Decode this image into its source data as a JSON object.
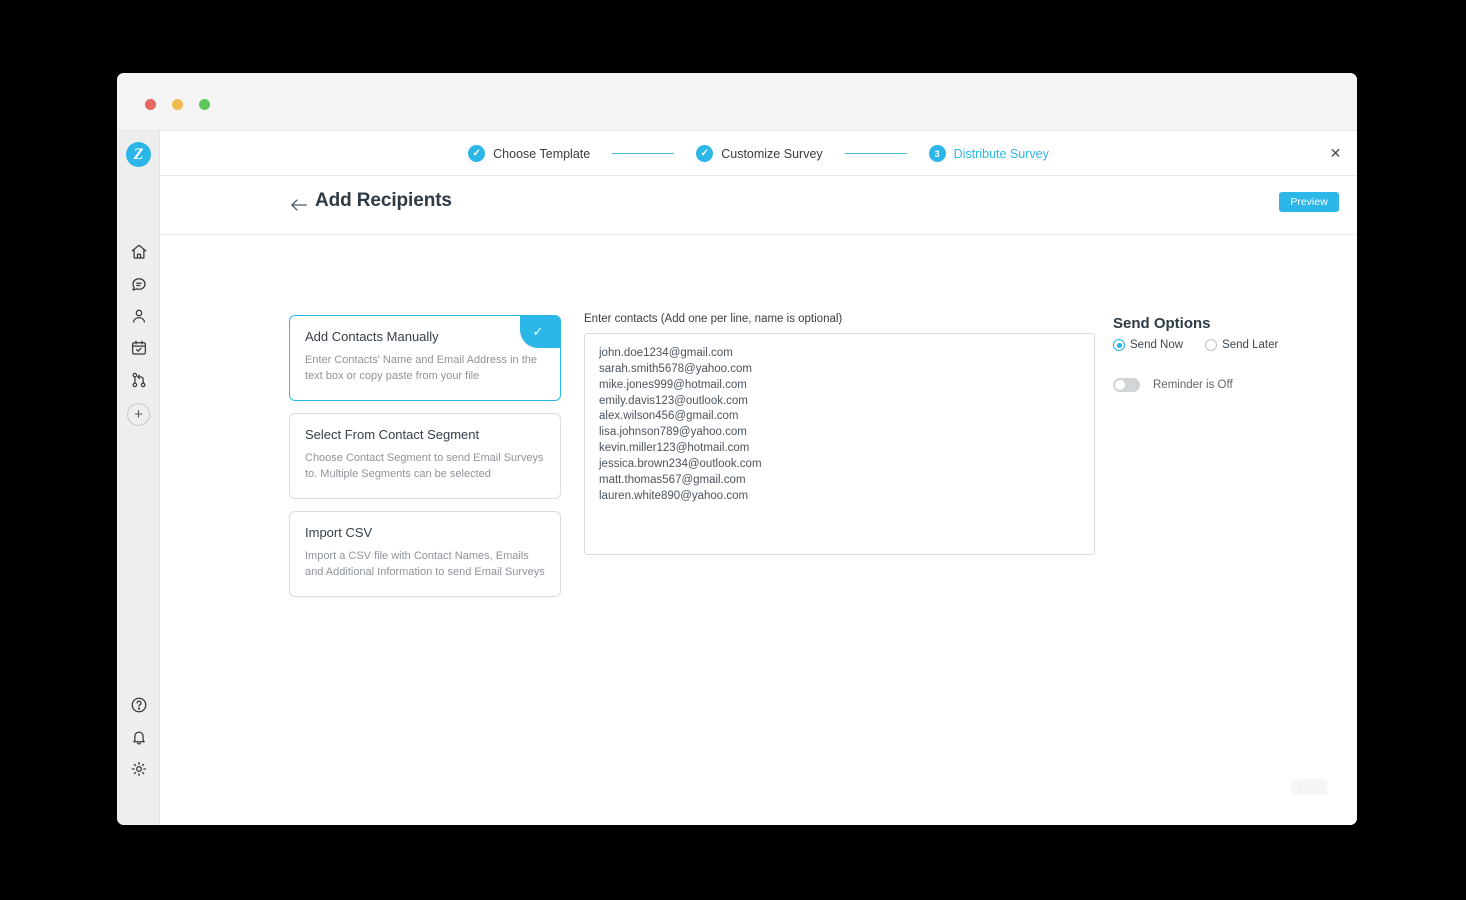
{
  "window": {
    "traffic_lights": [
      {
        "name": "close",
        "color": "#e8685f"
      },
      {
        "name": "minimize",
        "color": "#f0bc4f"
      },
      {
        "name": "maximize",
        "color": "#5ec75a"
      }
    ]
  },
  "sidebar": {
    "brand_letter": "Z",
    "top_items": [
      {
        "icon": "home-icon",
        "label": "Home"
      },
      {
        "icon": "chat-icon",
        "label": "Conversations"
      },
      {
        "icon": "user-icon",
        "label": "Contacts"
      },
      {
        "icon": "calendar-check-icon",
        "label": "Campaigns"
      },
      {
        "icon": "workflow-icon",
        "label": "Workflows"
      }
    ],
    "add_label": "+",
    "bottom_items": [
      {
        "icon": "help-icon",
        "label": "Help"
      },
      {
        "icon": "bell-icon",
        "label": "Notifications"
      },
      {
        "icon": "gear-icon",
        "label": "Settings"
      }
    ]
  },
  "stepper": {
    "steps": [
      {
        "badge": "✓",
        "label": "Choose Template",
        "state": "done"
      },
      {
        "badge": "✓",
        "label": "Customize Survey",
        "state": "done"
      },
      {
        "badge": "3",
        "label": "Distribute Survey",
        "state": "current"
      }
    ],
    "close_icon": "✕",
    "accent_color": "#2cb7e8"
  },
  "page": {
    "title": "Add Recipients",
    "back_icon": "arrow-left-icon",
    "preview_label": "Preview",
    "save_label": "Save"
  },
  "methods": [
    {
      "title": "Add Contacts Manually",
      "description": "Enter Contacts' Name and Email Address in the text box or copy paste from your file",
      "selected": true,
      "check_icon": "✓"
    },
    {
      "title": "Select From Contact Segment",
      "description": "Choose Contact Segment to send Email Surveys to. Multiple Segments can be selected",
      "selected": false
    },
    {
      "title": "Import CSV",
      "description": "Import a CSV file with Contact Names, Emails and Additional Information to send Email Surveys",
      "selected": false
    }
  ],
  "contacts": {
    "label": "Enter contacts (Add one per line, name is optional)",
    "placeholder": "Enter contacts (Add one per line, name is optional)",
    "value": "john.doe1234@gmail.com\nsarah.smith5678@yahoo.com\nmike.jones999@hotmail.com\nemily.davis123@outlook.com\nalex.wilson456@gmail.com\nlisa.johnson789@yahoo.com\nkevin.miller123@hotmail.com\njessica.brown234@outlook.com\nmatt.thomas567@gmail.com\nlauren.white890@yahoo.com",
    "emails": [
      "john.doe1234@gmail.com",
      "sarah.smith5678@yahoo.com",
      "mike.jones999@hotmail.com",
      "emily.davis123@outlook.com",
      "alex.wilson456@gmail.com",
      "lisa.johnson789@yahoo.com",
      "kevin.miller123@hotmail.com",
      "jessica.brown234@outlook.com",
      "matt.thomas567@gmail.com",
      "lauren.white890@yahoo.com"
    ]
  },
  "send_options": {
    "title": "Send Options",
    "options": [
      {
        "label": "Send Now",
        "selected": true
      },
      {
        "label": "Send Later",
        "selected": false
      }
    ],
    "reminder_label": "Reminder is Off",
    "reminder_on": false
  }
}
